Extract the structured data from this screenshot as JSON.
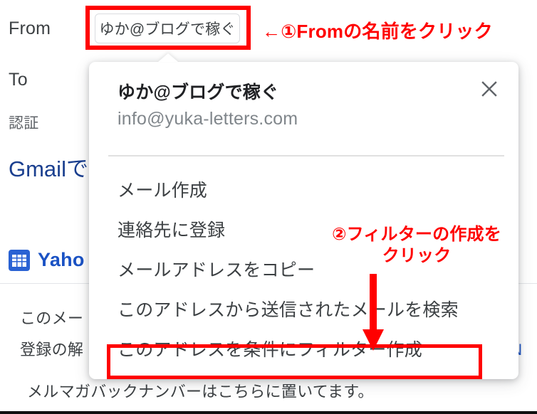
{
  "background": {
    "labels": {
      "from": "From",
      "to": "To",
      "auth": "認証"
    },
    "heading": "Gmailで",
    "promo": {
      "icon": "calendar-icon",
      "title": "Yaho"
    },
    "body_lines": [
      "このメー",
      "登録の解",
      "メルマガバックナンバーはこちらに置いてます。"
    ],
    "link_text": "?N"
  },
  "from_chip": {
    "value": "ゆか@ブログで稼ぐ"
  },
  "contact_card": {
    "name": "ゆか@ブログで稼ぐ",
    "email": "info@yuka-letters.com",
    "close_icon": "close-icon",
    "menu_items": [
      {
        "label": "メール作成"
      },
      {
        "label": "連絡先に登録"
      },
      {
        "label": "メールアドレスをコピー"
      },
      {
        "label": "このアドレスから送信されたメールを検索"
      },
      {
        "label": "このアドレスを条件にフィルター作成"
      }
    ]
  },
  "annotations": {
    "step1": "←①Fromの名前をクリック",
    "step2": "②フィルターの作成をクリック",
    "highlight_color": "#ff0000"
  }
}
